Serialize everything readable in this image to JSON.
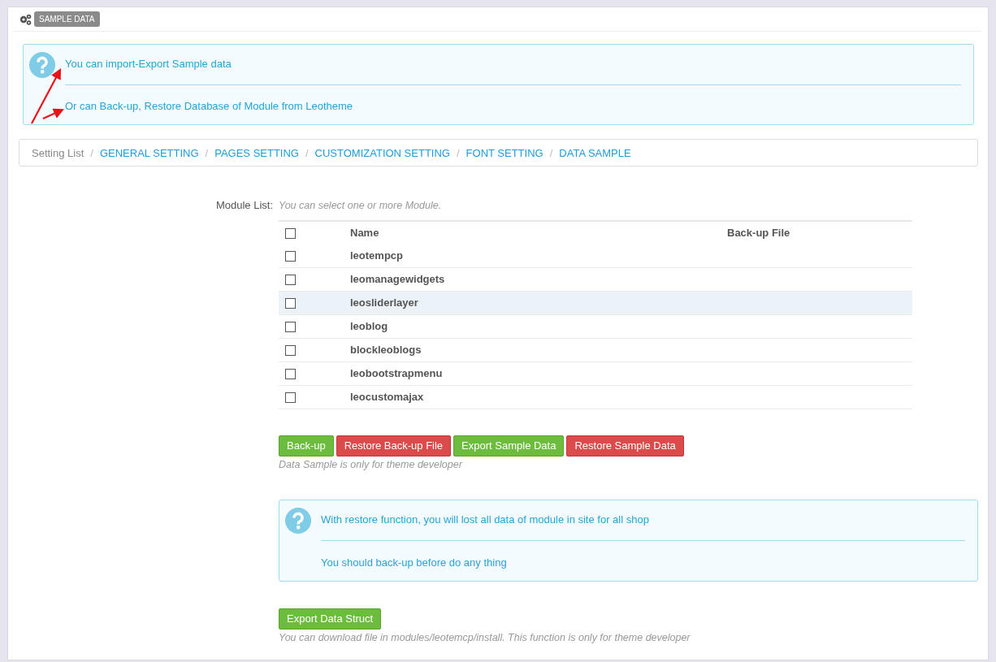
{
  "panel": {
    "title": "SAMPLE DATA"
  },
  "info_top": {
    "lines": [
      "You can import-Export Sample data",
      "Or can Back-up, Restore Database of Module from Leotheme"
    ]
  },
  "breadcrumb_separator": "/",
  "breadcrumb": [
    {
      "label": "Setting List",
      "kind": "text"
    },
    {
      "label": "GENERAL SETTING",
      "kind": "link"
    },
    {
      "label": "PAGES SETTING",
      "kind": "link"
    },
    {
      "label": "CUSTOMIZATION SETTING",
      "kind": "link"
    },
    {
      "label": "FONT SETTING",
      "kind": "link"
    },
    {
      "label": "DATA SAMPLE",
      "kind": "link"
    }
  ],
  "module_list": {
    "label": "Module List:",
    "hint": "You can select one or more Module.",
    "columns": [
      "Name",
      "Back-up File"
    ],
    "select_all": false,
    "rows": [
      {
        "name": "leotempcp",
        "checked": false,
        "highlighted": false
      },
      {
        "name": "leomanagewidgets",
        "checked": false,
        "highlighted": false
      },
      {
        "name": "leosliderlayer",
        "checked": false,
        "highlighted": true
      },
      {
        "name": "leoblog",
        "checked": false,
        "highlighted": false
      },
      {
        "name": "blockleoblogs",
        "checked": false,
        "highlighted": false
      },
      {
        "name": "leobootstrapmenu",
        "checked": false,
        "highlighted": false
      },
      {
        "name": "leocustomajax",
        "checked": false,
        "highlighted": false
      }
    ]
  },
  "actions": [
    {
      "label": "Back-up",
      "kind": "success"
    },
    {
      "label": "Restore Back-up File",
      "kind": "danger"
    },
    {
      "label": "Export Sample Data",
      "kind": "success"
    },
    {
      "label": "Restore Sample Data",
      "kind": "danger"
    }
  ],
  "actions_note": "Data Sample is only for theme developer",
  "info_restore": {
    "lines": [
      "With restore function, you will lost all data of module in site for all shop",
      "You should back-up before do any thing"
    ]
  },
  "struct_button": {
    "label": "Export Data Struct",
    "kind": "success"
  },
  "struct_note": "You can download file in modules/leotemcp/install. This function is only for theme developer"
}
